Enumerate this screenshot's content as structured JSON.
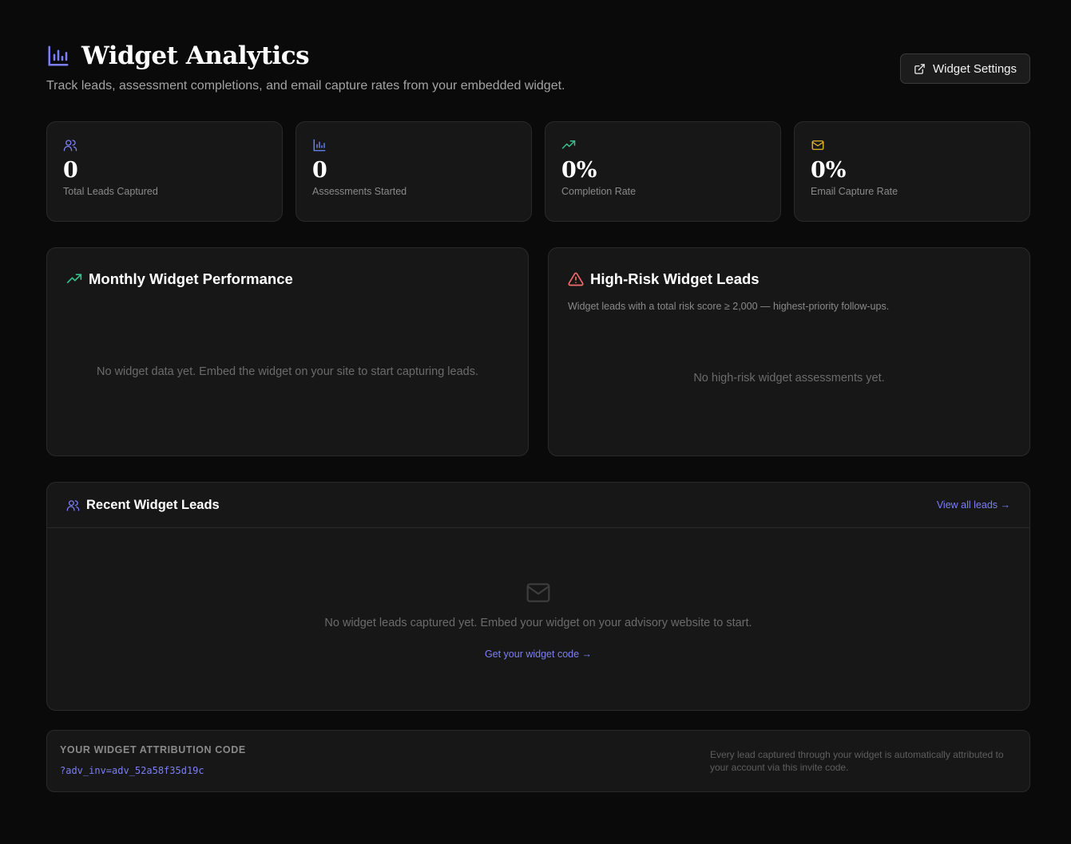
{
  "header": {
    "title": "Widget Analytics",
    "subtitle": "Track leads, assessment completions, and email capture rates from your embedded widget.",
    "settings_button": "Widget Settings"
  },
  "stats": [
    {
      "value": "0",
      "label": "Total Leads Captured",
      "icon": "users-icon",
      "color": "#7c7ff5"
    },
    {
      "value": "0",
      "label": "Assessments Started",
      "icon": "bar-chart-icon",
      "color": "#6b8cff"
    },
    {
      "value": "0%",
      "label": "Completion Rate",
      "icon": "trending-up-icon",
      "color": "#34c38f"
    },
    {
      "value": "0%",
      "label": "Email Capture Rate",
      "icon": "mail-icon",
      "color": "#e5b82e"
    }
  ],
  "performance": {
    "title": "Monthly Widget Performance",
    "empty": "No widget data yet. Embed the widget on your site to start capturing leads."
  },
  "high_risk": {
    "title": "High-Risk Widget Leads",
    "description": "Widget leads with a total risk score ≥ 2,000 — highest-priority follow-ups.",
    "empty": "No high-risk widget assessments yet."
  },
  "recent": {
    "title": "Recent Widget Leads",
    "view_all": "View all leads →",
    "empty": "No widget leads captured yet. Embed your widget on your advisory website to start.",
    "get_code": "Get your widget code →"
  },
  "attribution": {
    "label": "YOUR WIDGET ATTRIBUTION CODE",
    "code": "?adv_inv=adv_52a58f35d19c",
    "note": "Every lead captured through your widget is automatically attributed to your account via this invite code."
  },
  "colors": {
    "accent": "#7c7ff5",
    "danger": "#f26d6d",
    "success": "#34c38f",
    "warning": "#e5b82e"
  }
}
